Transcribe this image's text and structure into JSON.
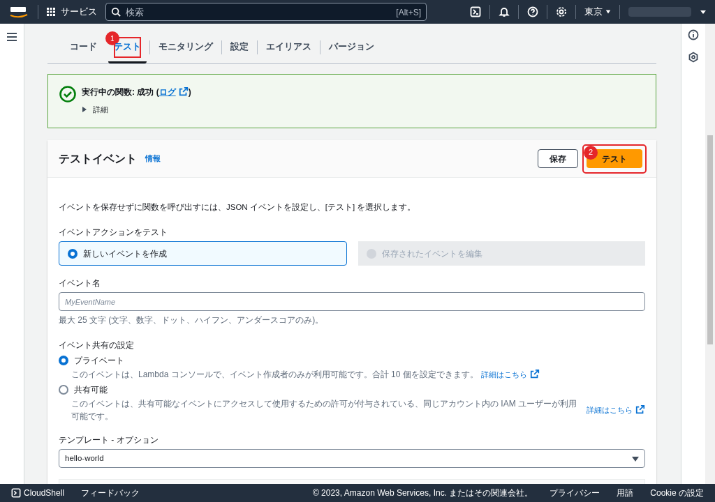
{
  "top_nav": {
    "services": "サービス",
    "search": {
      "placeholder": "検索",
      "shortcut": "[Alt+S]"
    },
    "region": "東京"
  },
  "tabs": [
    {
      "label": "コード",
      "selected": false,
      "highlighted": false
    },
    {
      "label": "テスト",
      "selected": true,
      "highlighted": true,
      "annotation": "1"
    },
    {
      "label": "モニタリング",
      "selected": false,
      "highlighted": false
    },
    {
      "label": "設定",
      "selected": false,
      "highlighted": false
    },
    {
      "label": "エイリアス",
      "selected": false,
      "highlighted": false
    },
    {
      "label": "バージョン",
      "selected": false,
      "highlighted": false
    }
  ],
  "alert": {
    "title": "実行中の関数: 成功 (",
    "link": "ログ",
    "title_end": ")",
    "details": "詳細"
  },
  "panel": {
    "title": "テストイベント",
    "info": "情報",
    "save_button": "保存",
    "test_button": {
      "label": "テスト",
      "annotation": "2"
    },
    "intro": "イベントを保存せずに関数を呼び出すには、JSON イベントを設定し、[テスト] を選択します。",
    "action_label": "イベントアクションをテスト",
    "actions": [
      {
        "label": "新しいイベントを作成",
        "selected": true,
        "disabled": false
      },
      {
        "label": "保存されたイベントを編集",
        "selected": false,
        "disabled": true
      }
    ],
    "name_label": "イベント名",
    "name_field": {
      "placeholder": "MyEventName"
    },
    "name_hint": "最大 25 文字 (文字、数字、ドット、ハイフン、アンダースコアのみ)。",
    "sharing_label": "イベント共有の設定",
    "sharing": [
      {
        "label": "プライベート",
        "selected": true,
        "description": "このイベントは、Lambda コンソールで、イベント作成者のみが利用可能です。合計 10 個を設定できます。",
        "link": "詳細はこちら"
      },
      {
        "label": "共有可能",
        "selected": false,
        "description": "このイベントは、共有可能なイベントにアクセスして使用するための許可が付与されている、同じアカウント内の IAM ユーザーが利用可能です。",
        "link": "詳細はこちら"
      }
    ],
    "template_label": "テンプレート - オプション",
    "template_value": "hello-world"
  },
  "footer": {
    "cloudshell": "CloudShell",
    "feedback": "フィードバック",
    "copyright": "© 2023, Amazon Web Services, Inc. またはその関連会社。",
    "links": [
      "プライバシー",
      "用語",
      "Cookie の設定"
    ]
  }
}
